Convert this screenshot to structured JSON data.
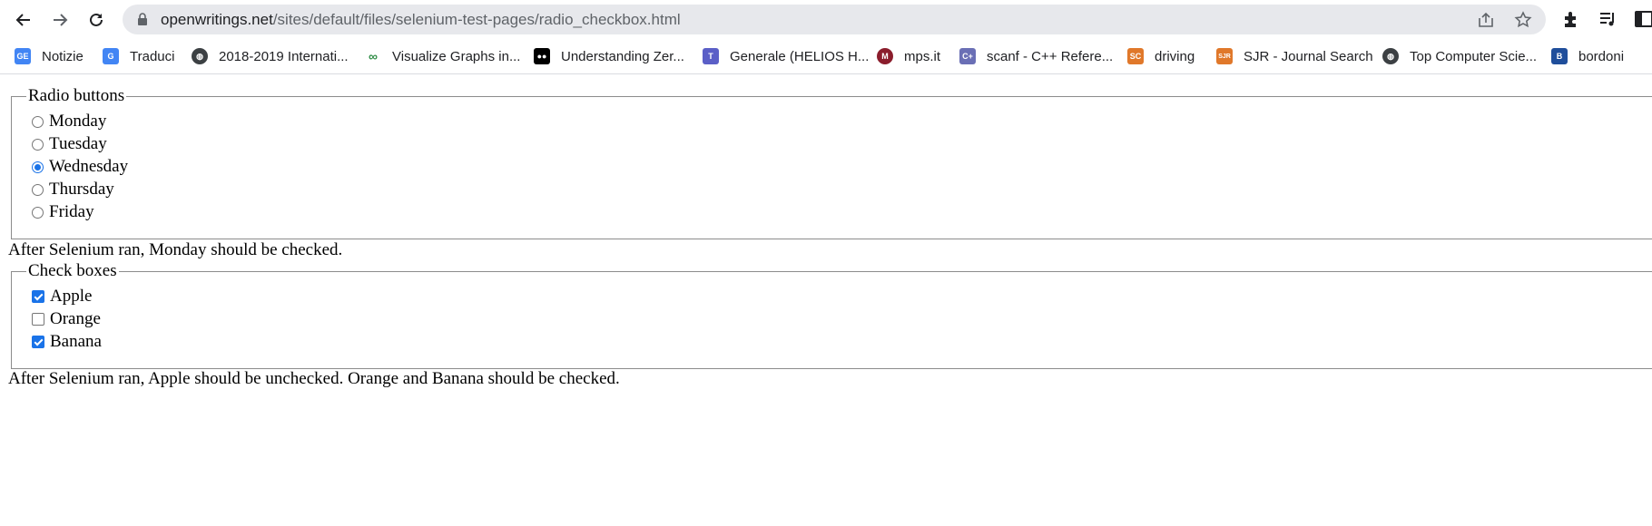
{
  "browser": {
    "url_host": "openwritings.net",
    "url_path": "/sites/default/files/selenium-test-pages/radio_checkbox.html",
    "icons": [
      "back-icon",
      "forward-icon",
      "reload-icon",
      "lock-icon",
      "share-icon",
      "star-icon",
      "extensions-icon",
      "media-icon",
      "sidepanel-icon"
    ]
  },
  "bookmarks": [
    {
      "label": "Notizie",
      "icon": "google-news-icon",
      "color": "#4285f4"
    },
    {
      "label": "Traduci",
      "icon": "google-translate-icon",
      "color": "#4285f4"
    },
    {
      "label": "2018-2019 Internati...",
      "icon": "globe-icon",
      "color": "#3c4043"
    },
    {
      "label": "Visualize Graphs in...",
      "icon": "geeks-icon",
      "color": "#2f8d46"
    },
    {
      "label": "Understanding Zer...",
      "icon": "medium-icon",
      "color": "#000000"
    },
    {
      "label": "Generale (HELIOS H...",
      "icon": "teams-icon",
      "color": "#5b5fc7"
    },
    {
      "label": "mps.it",
      "icon": "mps-icon",
      "color": "#8b1d2c"
    },
    {
      "label": "scanf - C++ Refere...",
      "icon": "cplusplus-icon",
      "color": "#6a6fb5"
    },
    {
      "label": "driving",
      "icon": "sc-icon",
      "color": "#e0782a"
    },
    {
      "label": "SJR - Journal Search",
      "icon": "sjr-icon",
      "color": "#e0782a"
    },
    {
      "label": "Top Computer Scie...",
      "icon": "globe-icon",
      "color": "#3c4043"
    },
    {
      "label": "bordoni",
      "icon": "bordoni-icon",
      "color": "#1f4e9b"
    }
  ],
  "radio_section": {
    "legend": "Radio buttons",
    "options": [
      {
        "label": "Monday",
        "checked": false
      },
      {
        "label": "Tuesday",
        "checked": false
      },
      {
        "label": "Wednesday",
        "checked": true
      },
      {
        "label": "Thursday",
        "checked": false
      },
      {
        "label": "Friday",
        "checked": false
      }
    ],
    "note": "After Selenium ran, Monday should be checked."
  },
  "checkbox_section": {
    "legend": "Check boxes",
    "options": [
      {
        "label": "Apple",
        "checked": true
      },
      {
        "label": "Orange",
        "checked": false
      },
      {
        "label": "Banana",
        "checked": true
      }
    ],
    "note": "After Selenium ran, Apple should be unchecked. Orange and Banana should be checked."
  },
  "colors": {
    "accent": "#1a73e8",
    "omnibox": "#e7e8ec",
    "fieldset_border": "#8c8c8c"
  }
}
